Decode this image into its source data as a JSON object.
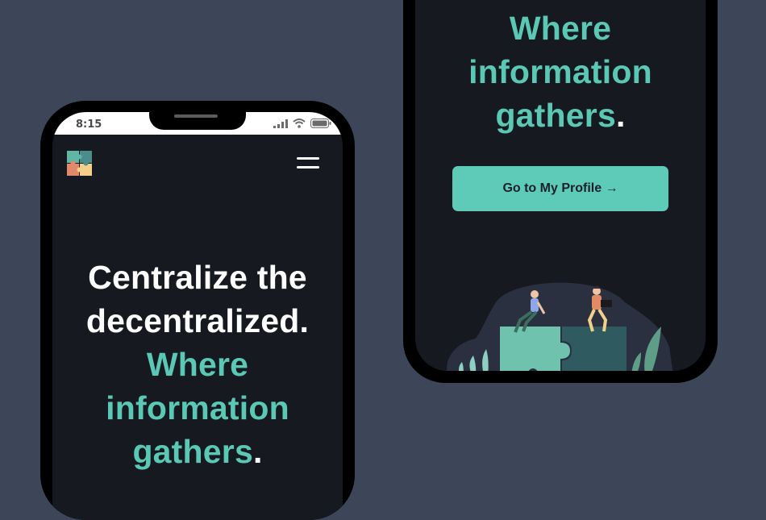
{
  "status_bar": {
    "time": "8:15"
  },
  "hero": {
    "line1": "Centralize the",
    "line2": "decentralized.",
    "highlight_line1": "Where",
    "highlight_line2": "information",
    "highlight_line3": "gathers",
    "period": "."
  },
  "cta": {
    "label": "Go to My Profile",
    "arrow": "→"
  },
  "colors": {
    "accent": "#5ac8b4",
    "background": "#3d4559",
    "screen": "#161920"
  }
}
